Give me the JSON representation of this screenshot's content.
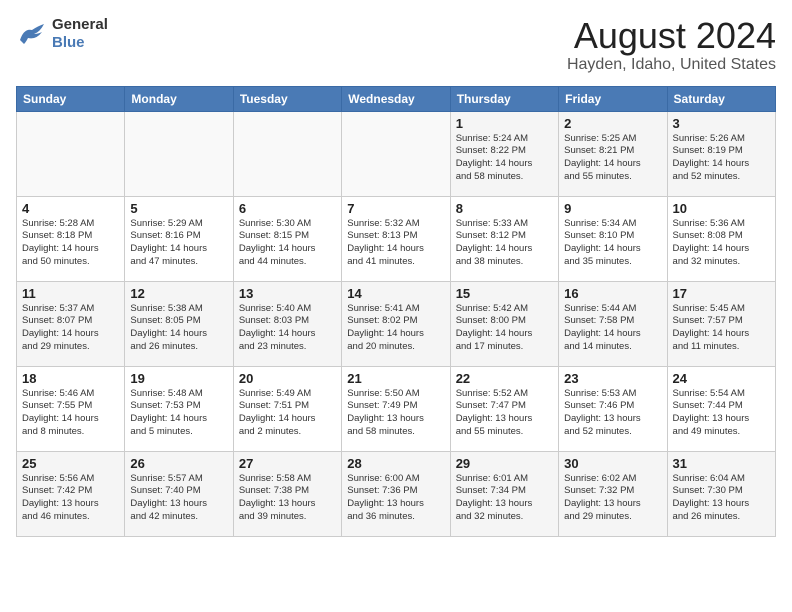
{
  "header": {
    "logo_line1": "General",
    "logo_line2": "Blue",
    "title": "August 2024",
    "subtitle": "Hayden, Idaho, United States"
  },
  "weekdays": [
    "Sunday",
    "Monday",
    "Tuesday",
    "Wednesday",
    "Thursday",
    "Friday",
    "Saturday"
  ],
  "weeks": [
    [
      {
        "day": "",
        "info": ""
      },
      {
        "day": "",
        "info": ""
      },
      {
        "day": "",
        "info": ""
      },
      {
        "day": "",
        "info": ""
      },
      {
        "day": "1",
        "info": "Sunrise: 5:24 AM\nSunset: 8:22 PM\nDaylight: 14 hours\nand 58 minutes."
      },
      {
        "day": "2",
        "info": "Sunrise: 5:25 AM\nSunset: 8:21 PM\nDaylight: 14 hours\nand 55 minutes."
      },
      {
        "day": "3",
        "info": "Sunrise: 5:26 AM\nSunset: 8:19 PM\nDaylight: 14 hours\nand 52 minutes."
      }
    ],
    [
      {
        "day": "4",
        "info": "Sunrise: 5:28 AM\nSunset: 8:18 PM\nDaylight: 14 hours\nand 50 minutes."
      },
      {
        "day": "5",
        "info": "Sunrise: 5:29 AM\nSunset: 8:16 PM\nDaylight: 14 hours\nand 47 minutes."
      },
      {
        "day": "6",
        "info": "Sunrise: 5:30 AM\nSunset: 8:15 PM\nDaylight: 14 hours\nand 44 minutes."
      },
      {
        "day": "7",
        "info": "Sunrise: 5:32 AM\nSunset: 8:13 PM\nDaylight: 14 hours\nand 41 minutes."
      },
      {
        "day": "8",
        "info": "Sunrise: 5:33 AM\nSunset: 8:12 PM\nDaylight: 14 hours\nand 38 minutes."
      },
      {
        "day": "9",
        "info": "Sunrise: 5:34 AM\nSunset: 8:10 PM\nDaylight: 14 hours\nand 35 minutes."
      },
      {
        "day": "10",
        "info": "Sunrise: 5:36 AM\nSunset: 8:08 PM\nDaylight: 14 hours\nand 32 minutes."
      }
    ],
    [
      {
        "day": "11",
        "info": "Sunrise: 5:37 AM\nSunset: 8:07 PM\nDaylight: 14 hours\nand 29 minutes."
      },
      {
        "day": "12",
        "info": "Sunrise: 5:38 AM\nSunset: 8:05 PM\nDaylight: 14 hours\nand 26 minutes."
      },
      {
        "day": "13",
        "info": "Sunrise: 5:40 AM\nSunset: 8:03 PM\nDaylight: 14 hours\nand 23 minutes."
      },
      {
        "day": "14",
        "info": "Sunrise: 5:41 AM\nSunset: 8:02 PM\nDaylight: 14 hours\nand 20 minutes."
      },
      {
        "day": "15",
        "info": "Sunrise: 5:42 AM\nSunset: 8:00 PM\nDaylight: 14 hours\nand 17 minutes."
      },
      {
        "day": "16",
        "info": "Sunrise: 5:44 AM\nSunset: 7:58 PM\nDaylight: 14 hours\nand 14 minutes."
      },
      {
        "day": "17",
        "info": "Sunrise: 5:45 AM\nSunset: 7:57 PM\nDaylight: 14 hours\nand 11 minutes."
      }
    ],
    [
      {
        "day": "18",
        "info": "Sunrise: 5:46 AM\nSunset: 7:55 PM\nDaylight: 14 hours\nand 8 minutes."
      },
      {
        "day": "19",
        "info": "Sunrise: 5:48 AM\nSunset: 7:53 PM\nDaylight: 14 hours\nand 5 minutes."
      },
      {
        "day": "20",
        "info": "Sunrise: 5:49 AM\nSunset: 7:51 PM\nDaylight: 14 hours\nand 2 minutes."
      },
      {
        "day": "21",
        "info": "Sunrise: 5:50 AM\nSunset: 7:49 PM\nDaylight: 13 hours\nand 58 minutes."
      },
      {
        "day": "22",
        "info": "Sunrise: 5:52 AM\nSunset: 7:47 PM\nDaylight: 13 hours\nand 55 minutes."
      },
      {
        "day": "23",
        "info": "Sunrise: 5:53 AM\nSunset: 7:46 PM\nDaylight: 13 hours\nand 52 minutes."
      },
      {
        "day": "24",
        "info": "Sunrise: 5:54 AM\nSunset: 7:44 PM\nDaylight: 13 hours\nand 49 minutes."
      }
    ],
    [
      {
        "day": "25",
        "info": "Sunrise: 5:56 AM\nSunset: 7:42 PM\nDaylight: 13 hours\nand 46 minutes."
      },
      {
        "day": "26",
        "info": "Sunrise: 5:57 AM\nSunset: 7:40 PM\nDaylight: 13 hours\nand 42 minutes."
      },
      {
        "day": "27",
        "info": "Sunrise: 5:58 AM\nSunset: 7:38 PM\nDaylight: 13 hours\nand 39 minutes."
      },
      {
        "day": "28",
        "info": "Sunrise: 6:00 AM\nSunset: 7:36 PM\nDaylight: 13 hours\nand 36 minutes."
      },
      {
        "day": "29",
        "info": "Sunrise: 6:01 AM\nSunset: 7:34 PM\nDaylight: 13 hours\nand 32 minutes."
      },
      {
        "day": "30",
        "info": "Sunrise: 6:02 AM\nSunset: 7:32 PM\nDaylight: 13 hours\nand 29 minutes."
      },
      {
        "day": "31",
        "info": "Sunrise: 6:04 AM\nSunset: 7:30 PM\nDaylight: 13 hours\nand 26 minutes."
      }
    ]
  ]
}
